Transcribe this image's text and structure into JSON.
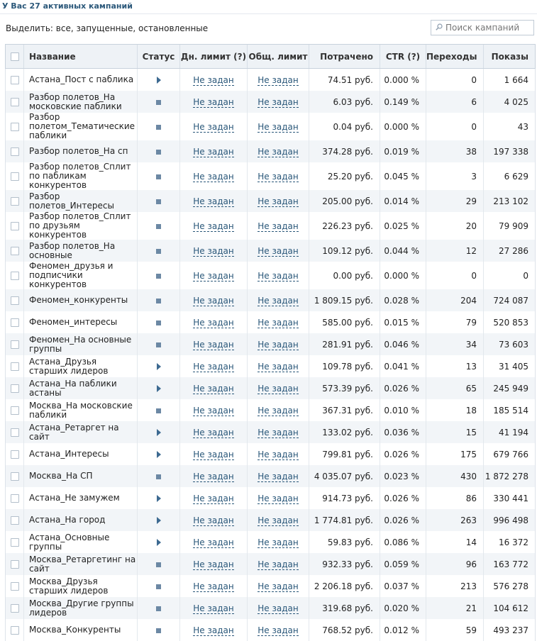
{
  "header": {
    "title": "У Вас 27 активных кампаний"
  },
  "filter": {
    "label": "Выделить: все, запущенные, остановленные"
  },
  "search": {
    "placeholder": "Поиск кампаний"
  },
  "columns": {
    "name": "Название",
    "status": "Статус",
    "daily_limit": "Дн. лимит (?)",
    "total_limit": "Общ. лимит",
    "spent": "Потрачено",
    "ctr": "CTR (?)",
    "clicks": "Переходы",
    "impressions": "Показы"
  },
  "colors": {
    "accent": "#2b587a",
    "header_bg": "#eef2f6",
    "alt_row_bg": "#f2f5f8",
    "status_running": "#3d6a91",
    "status_stopped": "#6c88a4"
  },
  "icons": {
    "search": "magnifier-icon",
    "status_running": "play-icon",
    "status_stopped": "stop-icon"
  },
  "campaigns": [
    {
      "name": "Астана_Пост с паблика",
      "status": "running",
      "daily_limit": "Не задан",
      "total_limit": "Не задан",
      "spent": "74.51 руб.",
      "ctr": "0.000 %",
      "clicks": "0",
      "impressions": "1 664"
    },
    {
      "name": "Разбор полетов_На московские паблики",
      "status": "stopped",
      "daily_limit": "Не задан",
      "total_limit": "Не задан",
      "spent": "6.03 руб.",
      "ctr": "0.149 %",
      "clicks": "6",
      "impressions": "4 025"
    },
    {
      "name": "Разбор полетом_Тематические паблики",
      "status": "stopped",
      "daily_limit": "Не задан",
      "total_limit": "Не задан",
      "spent": "0.04 руб.",
      "ctr": "0.000 %",
      "clicks": "0",
      "impressions": "43"
    },
    {
      "name": "Разбор полетов_На сп",
      "status": "stopped",
      "daily_limit": "Не задан",
      "total_limit": "Не задан",
      "spent": "374.28 руб.",
      "ctr": "0.019 %",
      "clicks": "38",
      "impressions": "197 338"
    },
    {
      "name": "Разбор полетов_Сплит по пабликам конкурентов",
      "status": "stopped",
      "daily_limit": "Не задан",
      "total_limit": "Не задан",
      "spent": "25.20 руб.",
      "ctr": "0.045 %",
      "clicks": "3",
      "impressions": "6 629"
    },
    {
      "name": "Разбор полетов_Интересы",
      "status": "stopped",
      "daily_limit": "Не задан",
      "total_limit": "Не задан",
      "spent": "205.00 руб.",
      "ctr": "0.014 %",
      "clicks": "29",
      "impressions": "213 102"
    },
    {
      "name": "Разбор полетов_Сплит по друзьям конкурентов",
      "status": "stopped",
      "daily_limit": "Не задан",
      "total_limit": "Не задан",
      "spent": "226.23 руб.",
      "ctr": "0.025 %",
      "clicks": "20",
      "impressions": "79 909"
    },
    {
      "name": "Разбор полетов_На основные",
      "status": "stopped",
      "daily_limit": "Не задан",
      "total_limit": "Не задан",
      "spent": "109.12 руб.",
      "ctr": "0.044 %",
      "clicks": "12",
      "impressions": "27 286"
    },
    {
      "name": "Феномен_друзья и подписчики конкурентов",
      "status": "stopped",
      "daily_limit": "Не задан",
      "total_limit": "Не задан",
      "spent": "0.00 руб.",
      "ctr": "0.000 %",
      "clicks": "0",
      "impressions": "0"
    },
    {
      "name": "Феномен_конкуренты",
      "status": "stopped",
      "daily_limit": "Не задан",
      "total_limit": "Не задан",
      "spent": "1 809.15 руб.",
      "ctr": "0.028 %",
      "clicks": "204",
      "impressions": "724 087"
    },
    {
      "name": "Феномен_интересы",
      "status": "stopped",
      "daily_limit": "Не задан",
      "total_limit": "Не задан",
      "spent": "585.00 руб.",
      "ctr": "0.015 %",
      "clicks": "79",
      "impressions": "520 853"
    },
    {
      "name": "Феномен_На основные группы",
      "status": "stopped",
      "daily_limit": "Не задан",
      "total_limit": "Не задан",
      "spent": "281.91 руб.",
      "ctr": "0.046 %",
      "clicks": "34",
      "impressions": "73 603"
    },
    {
      "name": "Астана_Друзья старших лидеров",
      "status": "running",
      "daily_limit": "Не задан",
      "total_limit": "Не задан",
      "spent": "109.78 руб.",
      "ctr": "0.041 %",
      "clicks": "13",
      "impressions": "31 405"
    },
    {
      "name": "Астана_На паблики астаны",
      "status": "running",
      "daily_limit": "Не задан",
      "total_limit": "Не задан",
      "spent": "573.39 руб.",
      "ctr": "0.026 %",
      "clicks": "65",
      "impressions": "245 949"
    },
    {
      "name": "Москва_На московские паблики",
      "status": "stopped",
      "daily_limit": "Не задан",
      "total_limit": "Не задан",
      "spent": "367.31 руб.",
      "ctr": "0.010 %",
      "clicks": "18",
      "impressions": "185 514"
    },
    {
      "name": "Астана_Ретаргет на сайт",
      "status": "running",
      "daily_limit": "Не задан",
      "total_limit": "Не задан",
      "spent": "133.02 руб.",
      "ctr": "0.036 %",
      "clicks": "15",
      "impressions": "41 194"
    },
    {
      "name": "Астана_Интересы",
      "status": "running",
      "daily_limit": "Не задан",
      "total_limit": "Не задан",
      "spent": "799.81 руб.",
      "ctr": "0.026 %",
      "clicks": "175",
      "impressions": "679 766"
    },
    {
      "name": "Москва_На СП",
      "status": "stopped",
      "daily_limit": "Не задан",
      "total_limit": "Не задан",
      "spent": "4 035.07 руб.",
      "ctr": "0.023 %",
      "clicks": "430",
      "impressions": "1 872 278"
    },
    {
      "name": "Астана_Не замужем",
      "status": "running",
      "daily_limit": "Не задан",
      "total_limit": "Не задан",
      "spent": "914.73 руб.",
      "ctr": "0.026 %",
      "clicks": "86",
      "impressions": "330 441"
    },
    {
      "name": "Астана_На город",
      "status": "running",
      "daily_limit": "Не задан",
      "total_limit": "Не задан",
      "spent": "1 774.81 руб.",
      "ctr": "0.026 %",
      "clicks": "263",
      "impressions": "996 498"
    },
    {
      "name": "Астана_Основные группы",
      "status": "running",
      "daily_limit": "Не задан",
      "total_limit": "Не задан",
      "spent": "59.83 руб.",
      "ctr": "0.086 %",
      "clicks": "14",
      "impressions": "16 372"
    },
    {
      "name": "Москва_Ретаргетинг на сайт",
      "status": "stopped",
      "daily_limit": "Не задан",
      "total_limit": "Не задан",
      "spent": "932.33 руб.",
      "ctr": "0.059 %",
      "clicks": "96",
      "impressions": "163 772"
    },
    {
      "name": "Москва_Друзья старших лидеров",
      "status": "stopped",
      "daily_limit": "Не задан",
      "total_limit": "Не задан",
      "spent": "2 206.18 руб.",
      "ctr": "0.037 %",
      "clicks": "213",
      "impressions": "576 278"
    },
    {
      "name": "Москва_Другие группы лидеров",
      "status": "stopped",
      "daily_limit": "Не задан",
      "total_limit": "Не задан",
      "spent": "319.68 руб.",
      "ctr": "0.020 %",
      "clicks": "21",
      "impressions": "104 612"
    },
    {
      "name": "Москва_Конкуренты",
      "status": "stopped",
      "daily_limit": "Не задан",
      "total_limit": "Не задан",
      "spent": "768.52 руб.",
      "ctr": "0.012 %",
      "clicks": "59",
      "impressions": "493 237"
    }
  ]
}
